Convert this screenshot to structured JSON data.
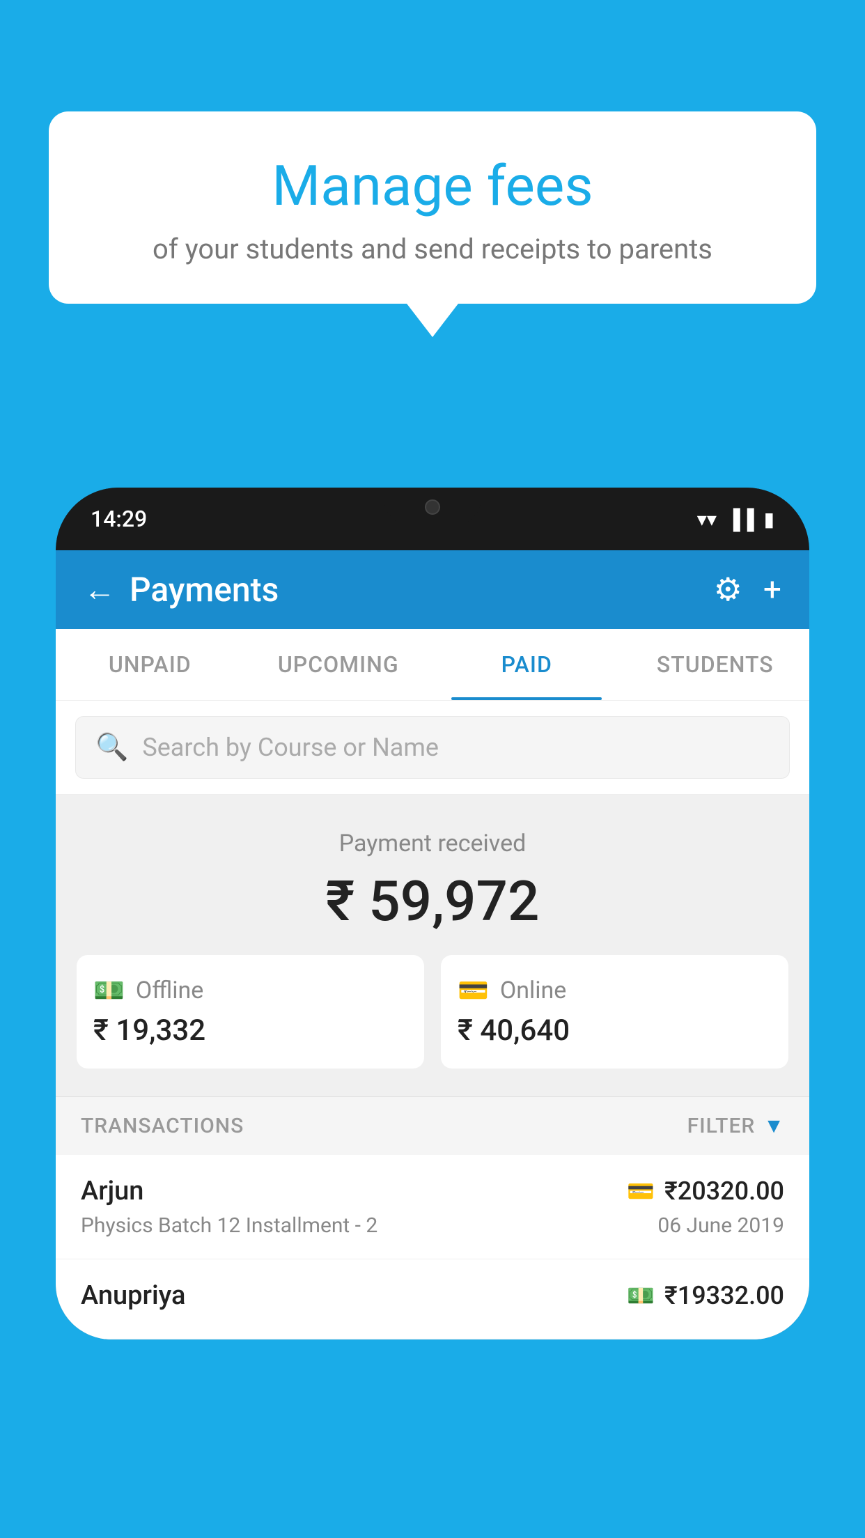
{
  "background_color": "#1AACE8",
  "bubble": {
    "title": "Manage fees",
    "subtitle": "of your students and send receipts to parents"
  },
  "phone": {
    "status_bar": {
      "time": "14:29"
    },
    "header": {
      "title": "Payments",
      "back_label": "←",
      "settings_icon": "gear",
      "add_icon": "+"
    },
    "tabs": [
      {
        "label": "UNPAID",
        "active": false
      },
      {
        "label": "UPCOMING",
        "active": false
      },
      {
        "label": "PAID",
        "active": true
      },
      {
        "label": "STUDENTS",
        "active": false
      }
    ],
    "search": {
      "placeholder": "Search by Course or Name"
    },
    "payment_received": {
      "label": "Payment received",
      "amount": "₹ 59,972",
      "offline": {
        "label": "Offline",
        "amount": "₹ 19,332"
      },
      "online": {
        "label": "Online",
        "amount": "₹ 40,640"
      }
    },
    "transactions": {
      "header_label": "TRANSACTIONS",
      "filter_label": "FILTER",
      "items": [
        {
          "name": "Arjun",
          "course": "Physics Batch 12 Installment - 2",
          "amount": "₹20320.00",
          "date": "06 June 2019",
          "payment_type": "card"
        },
        {
          "name": "Anupriya",
          "course": "",
          "amount": "₹19332.00",
          "date": "",
          "payment_type": "cash"
        }
      ]
    }
  }
}
